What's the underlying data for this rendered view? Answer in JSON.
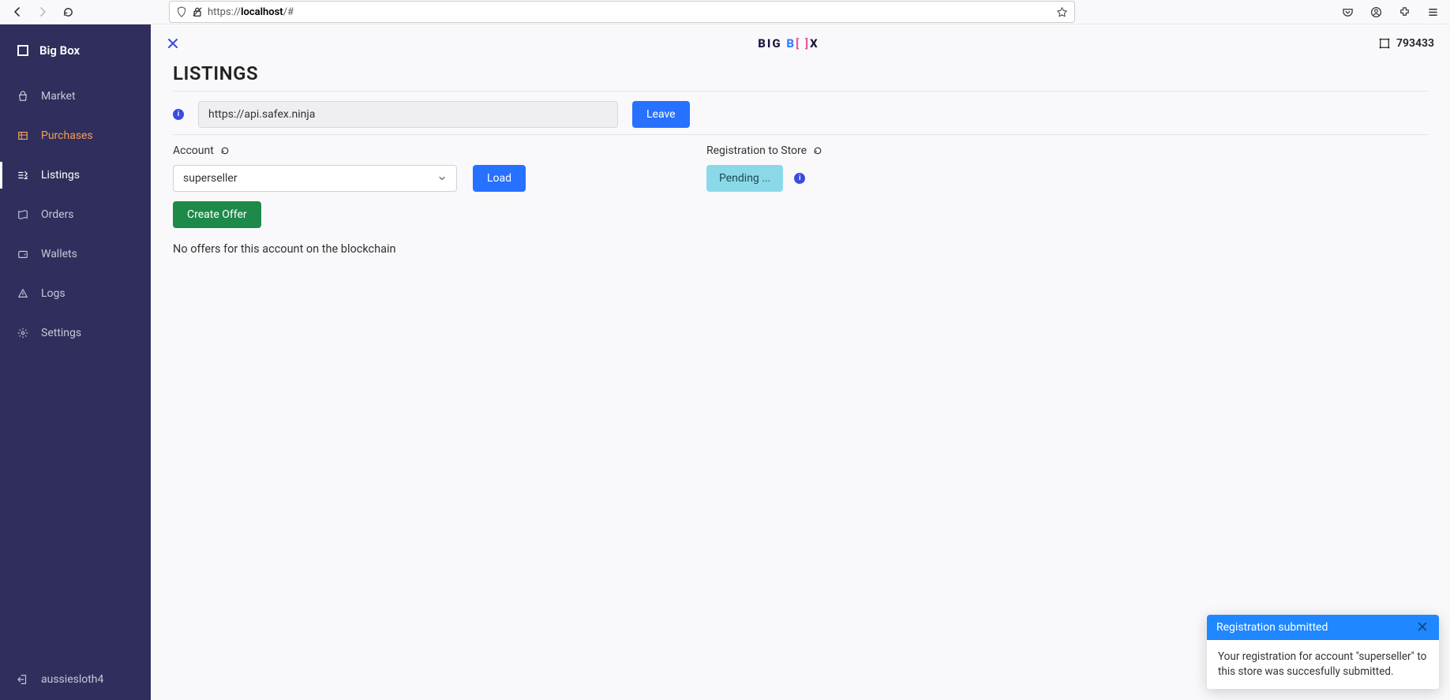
{
  "browser": {
    "url_prefix": "https://",
    "url_host": "localhost",
    "url_suffix": "/#"
  },
  "sidebar": {
    "brand": "Big Box",
    "items": [
      {
        "label": "Market"
      },
      {
        "label": "Purchases"
      },
      {
        "label": "Listings"
      },
      {
        "label": "Orders"
      },
      {
        "label": "Wallets"
      },
      {
        "label": "Logs"
      },
      {
        "label": "Settings"
      }
    ],
    "footer_user": "aussiesloth4"
  },
  "topbar": {
    "block_height": "793433"
  },
  "page": {
    "title": "LISTINGS",
    "api_url": "https://api.safex.ninja",
    "leave_label": "Leave",
    "account_label": "Account",
    "account_selected": "superseller",
    "load_label": "Load",
    "create_offer_label": "Create Offer",
    "registration_label": "Registration to Store",
    "registration_status": "Pending ...",
    "no_offers_text": "No offers for this account on the blockchain"
  },
  "toast": {
    "title": "Registration submitted",
    "body": "Your registration for account \"superseller\" to this store was succesfully submitted."
  }
}
